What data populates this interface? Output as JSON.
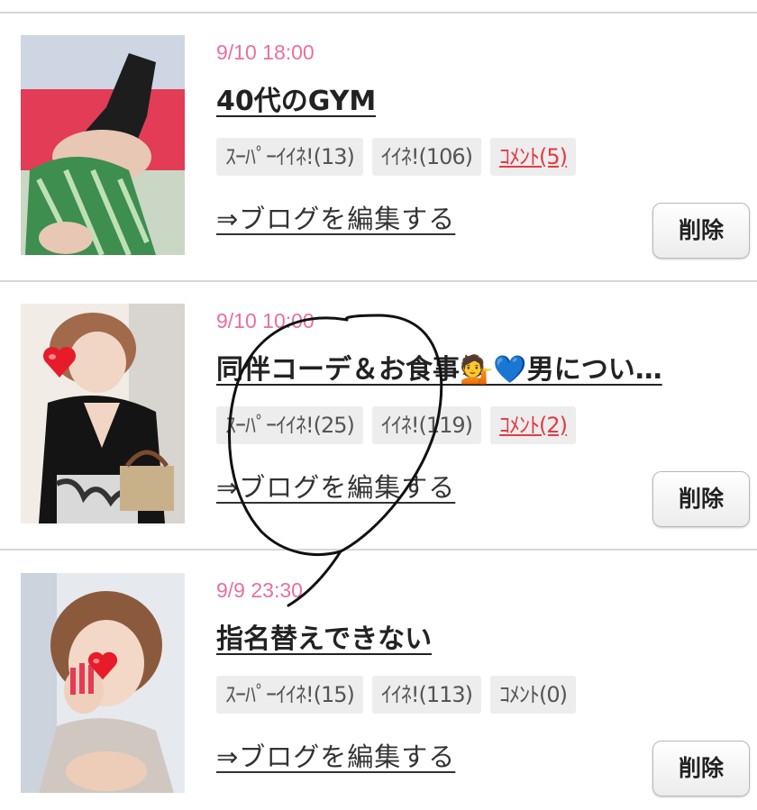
{
  "entries": [
    {
      "date": "9/10 18:00",
      "title": "40代のGYM",
      "super_like": "ｽｰﾊﾟｰｲｲﾈ!(13)",
      "like": "ｲｲﾈ!(106)",
      "comment": "ｺﾒﾝﾄ(5)",
      "edit_link": "⇒ブログを編集する",
      "delete_label": "削除"
    },
    {
      "date": "9/10 10:00",
      "title": "同伴コーデ＆お食事💁💙男につい…",
      "super_like": "ｽｰﾊﾟｰｲｲﾈ!(25)",
      "like": "ｲｲﾈ!(119)",
      "comment": "ｺﾒﾝﾄ(2)",
      "edit_link": "⇒ブログを編集する",
      "delete_label": "削除"
    },
    {
      "date": "9/9 23:30",
      "title": "指名替えできない",
      "super_like": "ｽｰﾊﾟｰｲｲﾈ!(15)",
      "like": "ｲｲﾈ!(113)",
      "comment": "ｺﾒﾝﾄ(0)",
      "edit_link": "⇒ブログを編集する",
      "delete_label": "削除"
    }
  ],
  "colors": {
    "date": "#ea6fa1",
    "comment_active": "#e33b45",
    "badge_bg": "#ededed"
  },
  "icons": [
    "heart-sticker-icon"
  ]
}
